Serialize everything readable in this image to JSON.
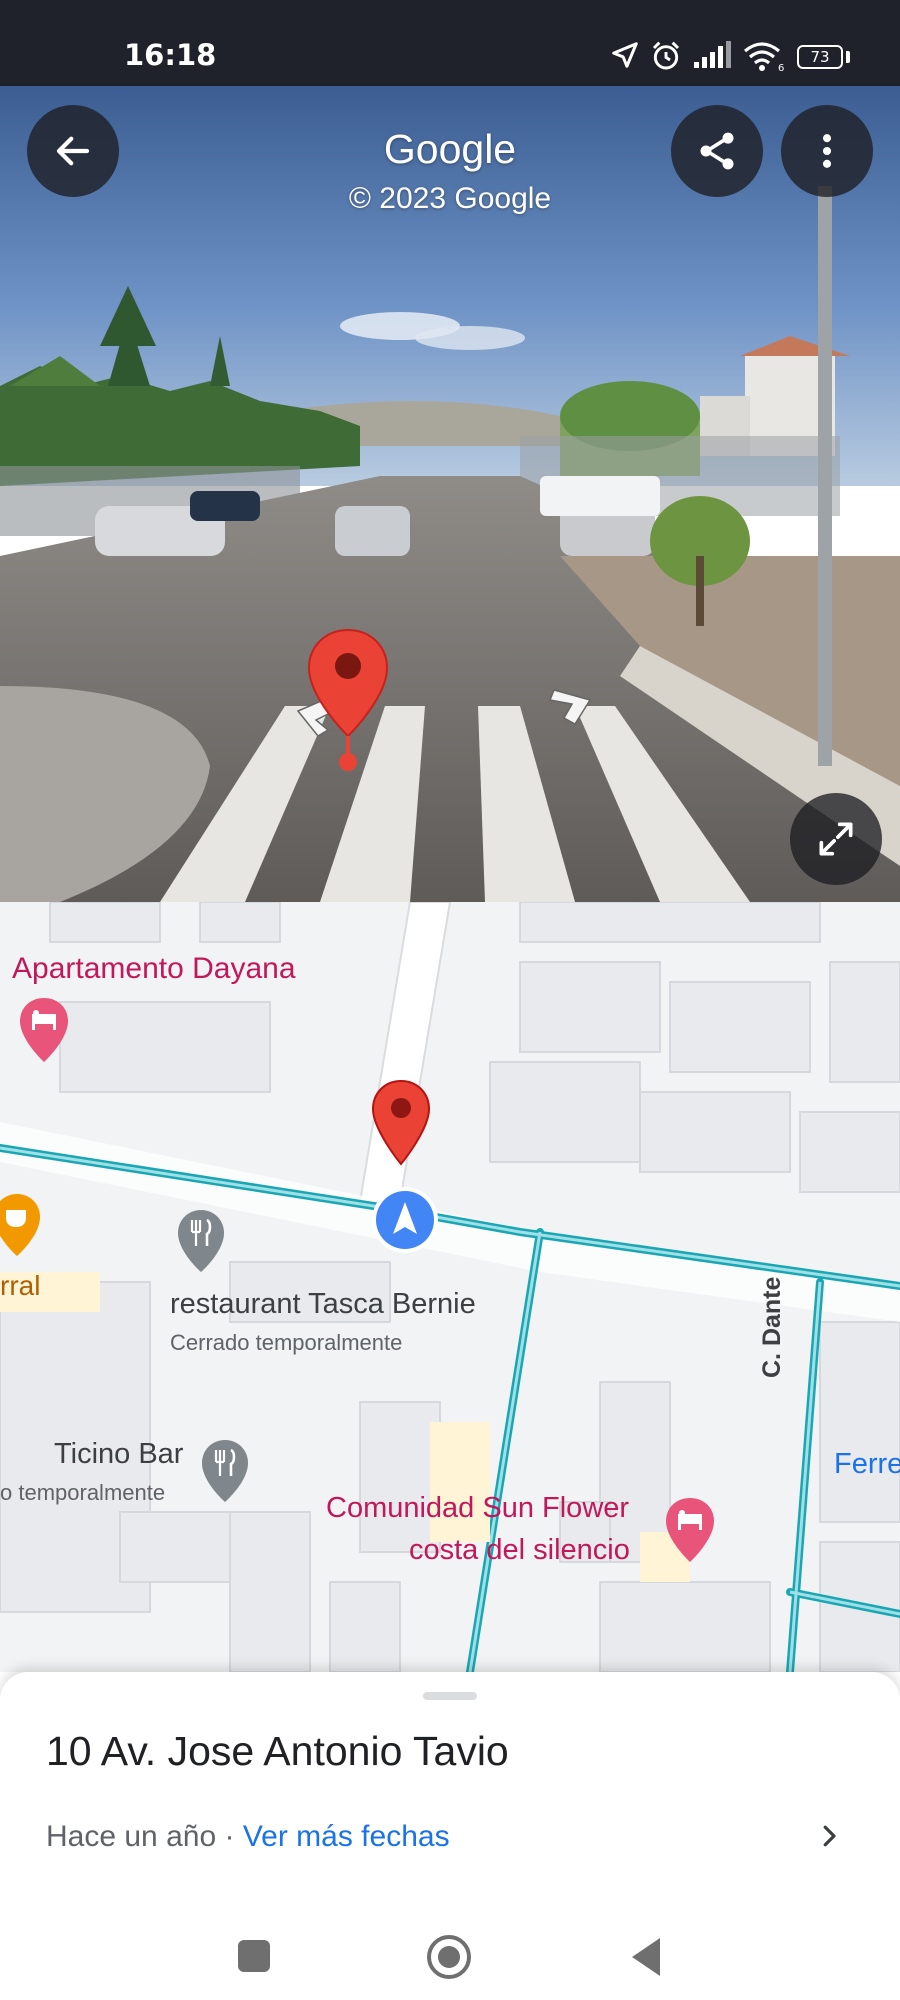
{
  "status_bar": {
    "time": "16:18",
    "battery": "73",
    "icons": [
      "location-arrow-icon",
      "alarm-icon",
      "signal-icon",
      "wifi-icon",
      "battery-icon"
    ]
  },
  "street_view": {
    "title": "Google",
    "copyright": "© 2023 Google",
    "buttons": [
      "back-arrow-icon",
      "share-icon",
      "more-vert-icon",
      "fullscreen-icon"
    ]
  },
  "map": {
    "places": [
      {
        "name": "Apartamento Dayana",
        "icon": "hotel-icon"
      },
      {
        "name": "restaurant Tasca Bernie",
        "status": "Cerrado temporalmente",
        "icon": "restaurant-icon"
      },
      {
        "name": "Ticino Bar",
        "status": "o temporalmente",
        "icon": "restaurant-icon"
      },
      {
        "name": "Comunidad Sun Flower",
        "name_line2": "costa del silencio",
        "icon": "hotel-icon"
      },
      {
        "name": "rral",
        "icon": "cafe-icon"
      },
      {
        "name": "Ferre"
      }
    ],
    "street": "C. Dante"
  },
  "sheet": {
    "address": "10 Av. Jose Antonio Tavio",
    "date": "Hace un año",
    "separator": " · ",
    "more_dates": "Ver más fechas"
  },
  "colors": {
    "status_bar": "#1f222a",
    "pin_red": "#ea4335",
    "route_teal": "#1ba6b4",
    "location_blue": "#4285f4",
    "place_pink": "#c2185b",
    "link_blue": "#1a73e8"
  }
}
